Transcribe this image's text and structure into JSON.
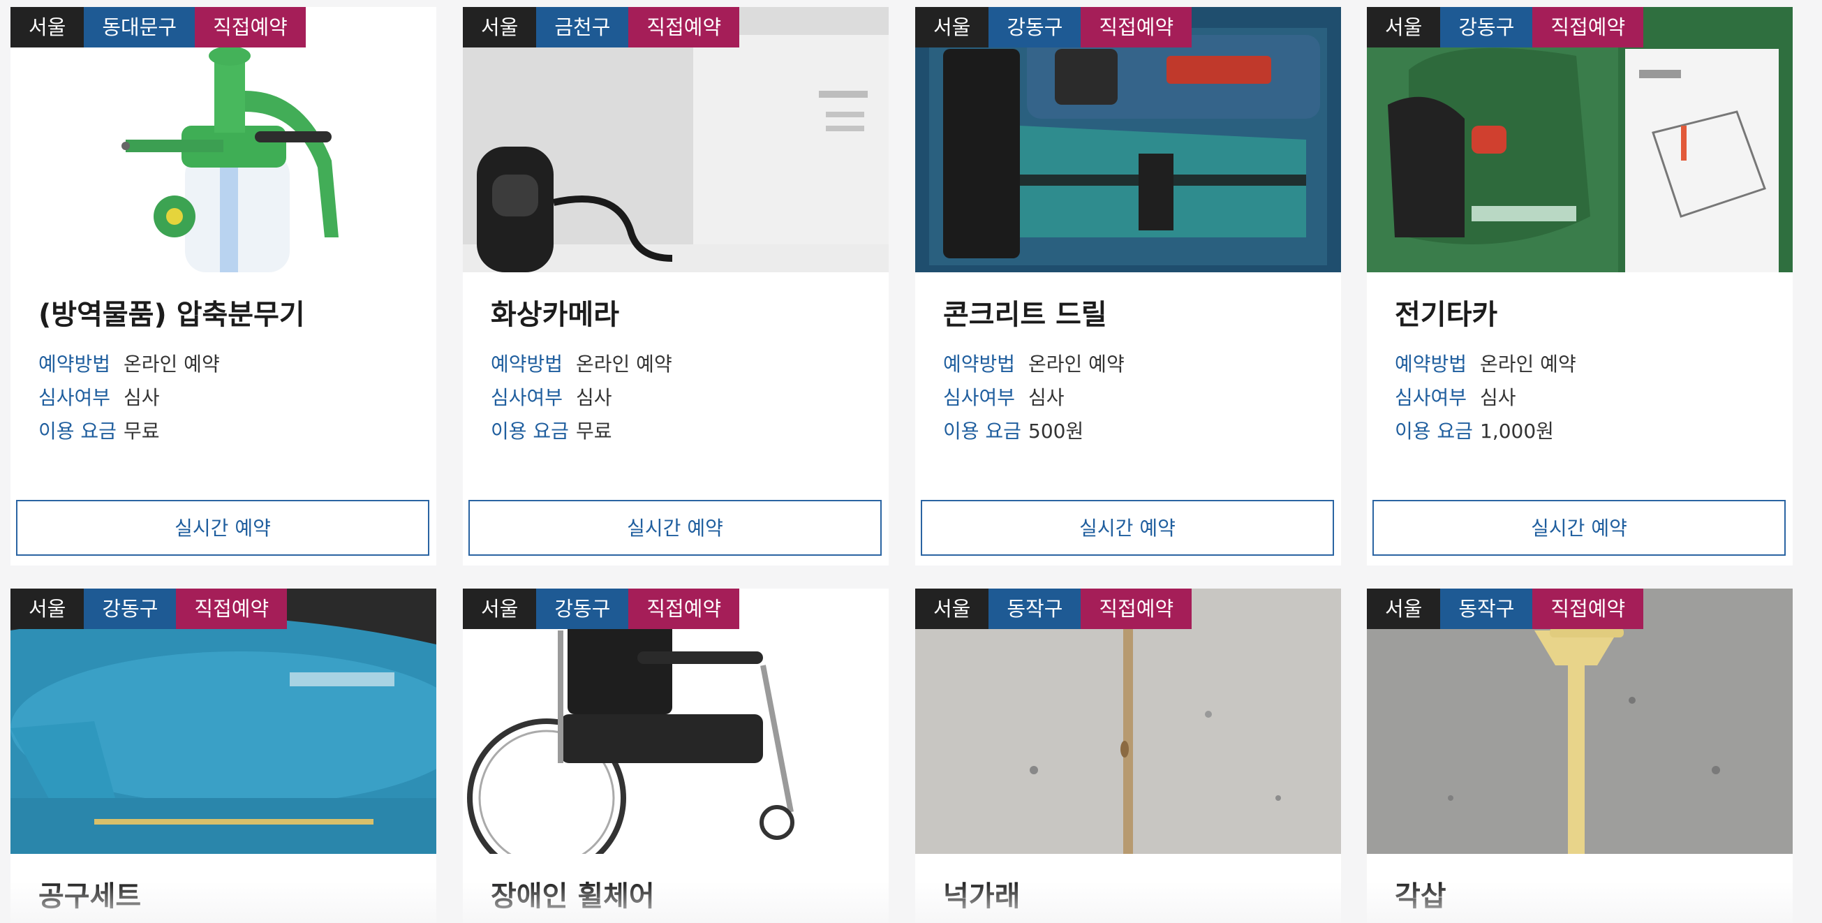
{
  "cards": [
    {
      "region": "서울",
      "district": "동대문구",
      "type": "직접예약",
      "title": "(방역물품) 압축분무기",
      "labels": {
        "method": "예약방법",
        "review": "심사여부",
        "fee": "이용 요금"
      },
      "method": "온라인 예약",
      "review": "심사",
      "fee": "무료",
      "button": "실시간 예약",
      "image": "pressure-sprayer"
    },
    {
      "region": "서울",
      "district": "금천구",
      "type": "직접예약",
      "title": "화상카메라",
      "labels": {
        "method": "예약방법",
        "review": "심사여부",
        "fee": "이용 요금"
      },
      "method": "온라인 예약",
      "review": "심사",
      "fee": "무료",
      "button": "실시간 예약",
      "image": "webcam"
    },
    {
      "region": "서울",
      "district": "강동구",
      "type": "직접예약",
      "title": "콘크리트 드릴",
      "labels": {
        "method": "예약방법",
        "review": "심사여부",
        "fee": "이용 요금"
      },
      "method": "온라인 예약",
      "review": "심사",
      "fee": "500원",
      "button": "실시간 예약",
      "image": "drill-case"
    },
    {
      "region": "서울",
      "district": "강동구",
      "type": "직접예약",
      "title": "전기타카",
      "labels": {
        "method": "예약방법",
        "review": "심사여부",
        "fee": "이용 요금"
      },
      "method": "온라인 예약",
      "review": "심사",
      "fee": "1,000원",
      "button": "실시간 예약",
      "image": "electric-tacker"
    },
    {
      "region": "서울",
      "district": "강동구",
      "type": "직접예약",
      "title": "공구세트",
      "image": "tool-case"
    },
    {
      "region": "서울",
      "district": "강동구",
      "type": "직접예약",
      "title": "장애인 휠체어",
      "image": "wheelchair"
    },
    {
      "region": "서울",
      "district": "동작구",
      "type": "직접예약",
      "title": "넉가래",
      "image": "snow-pusher"
    },
    {
      "region": "서울",
      "district": "동작구",
      "type": "직접예약",
      "title": "각삽",
      "image": "square-shovel"
    }
  ],
  "colors": {
    "region": "#222222",
    "district": "#1e5a94",
    "type": "#a51e58",
    "label": "#1f5e9e",
    "button_border": "#2a64a2"
  }
}
